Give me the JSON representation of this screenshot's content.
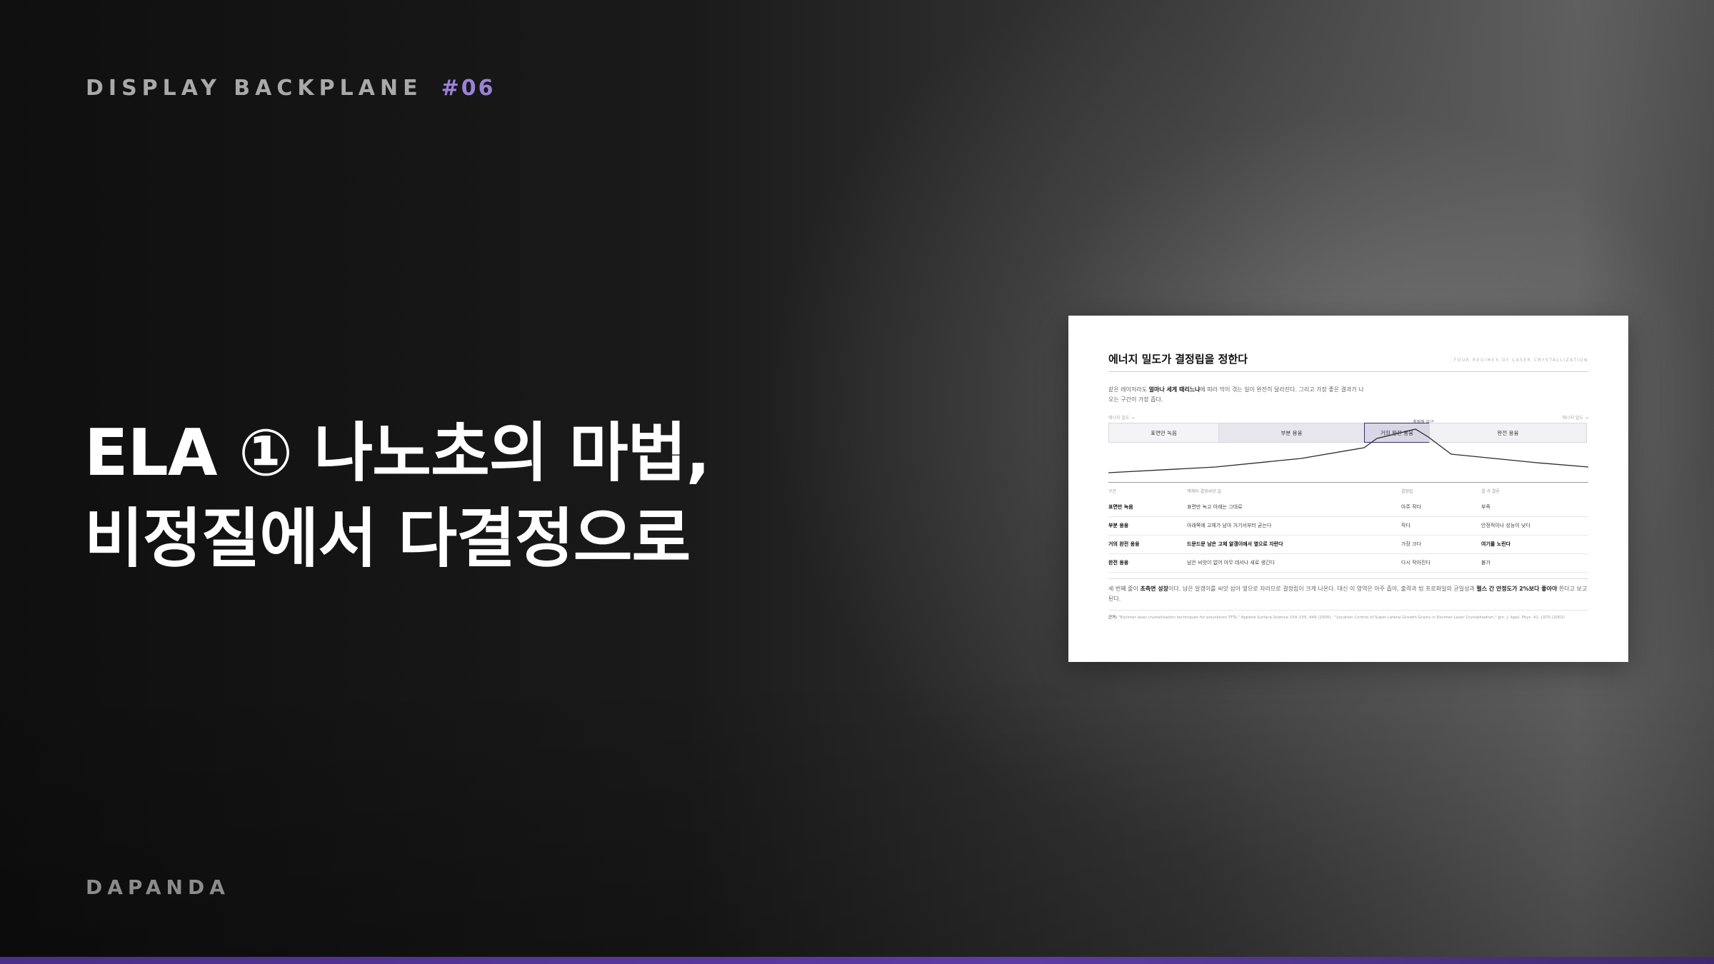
{
  "header": {
    "series_label": "DISPLAY BACKPLANE",
    "episode_number": "#06"
  },
  "headline": {
    "line1": "ELA ① 나노초의 마법,",
    "line2": "비정질에서 다결정으로"
  },
  "footer": {
    "brand": "DAPANDA"
  },
  "colors": {
    "accent": "#9b82d6",
    "bottom_bar": "#5d3ca6",
    "highlight_band": "#3d3166"
  },
  "thumbnail": {
    "title": "에너지 밀도가 결정립을 정한다",
    "eyebrow": "FOUR REGIMES OF LASER CRYSTALLIZATION",
    "intro_pre": "같은 레이저라도 ",
    "intro_bold": "얼마나 세게 때리느냐",
    "intro_post": "에 따라 막이 겪는 일이 완전히 달라진다. 그리고 가장 좋은 결과가 나오는 구간이 가장 좁다.",
    "axis_left": "에너지 밀도 →",
    "axis_right": "에너지 밀도 →",
    "peak_label": "최적점 부근",
    "bands": [
      "표면만 녹음",
      "부분 용융",
      "거의 완전 용융",
      "완전 용융"
    ],
    "table": {
      "headers": [
        "구간",
        "액체와 결정씨앗 일",
        "결정립",
        "결 과 결론"
      ],
      "rows": [
        [
          "표면만 녹음",
          "표면만 녹고 아래는 그대로",
          "아주 작다",
          "부족"
        ],
        [
          "부분 용융",
          "아래쪽에 고체가 남아 거기서부터 굳는다",
          "작다",
          "안정적이나 성능이 낮다"
        ],
        [
          "거의 완전 용융",
          "드문드문 남은 고체 알갱이에서 옆으로 자란다",
          "가장 크다",
          "여기를 노린다"
        ],
        [
          "완전 용융",
          "남은 씨앗이 없어 아무 데서나 새로 생긴다",
          "다시 작아진다",
          "불가"
        ]
      ]
    },
    "summary_pre": "세 번째 줄이 ",
    "summary_bold1": "초측면 성장",
    "summary_mid": "이다. 남은 알갱이를 씨앗 삼아 옆으로 자라므로 결정립이 크게 나온다. 대신 이 영역은 아주 좁아, 출력과 빔 프로파일의 균일성과 ",
    "summary_bold2": "펄스 간 안정도가 2%보다 좋아야",
    "summary_post": " 한다고 보고된다.",
    "source_label": "근거:",
    "source_text": "\"Excimer laser crystallization techniques for polysilicon TFTs,\" Applied Surface Science 154–155, 449 (2000) · \"Location Control of Super Lateral Growth Grains in Excimer Laser Crystallization,\" Jpn. J. Appl. Phys. 41, L970 (2002)"
  }
}
